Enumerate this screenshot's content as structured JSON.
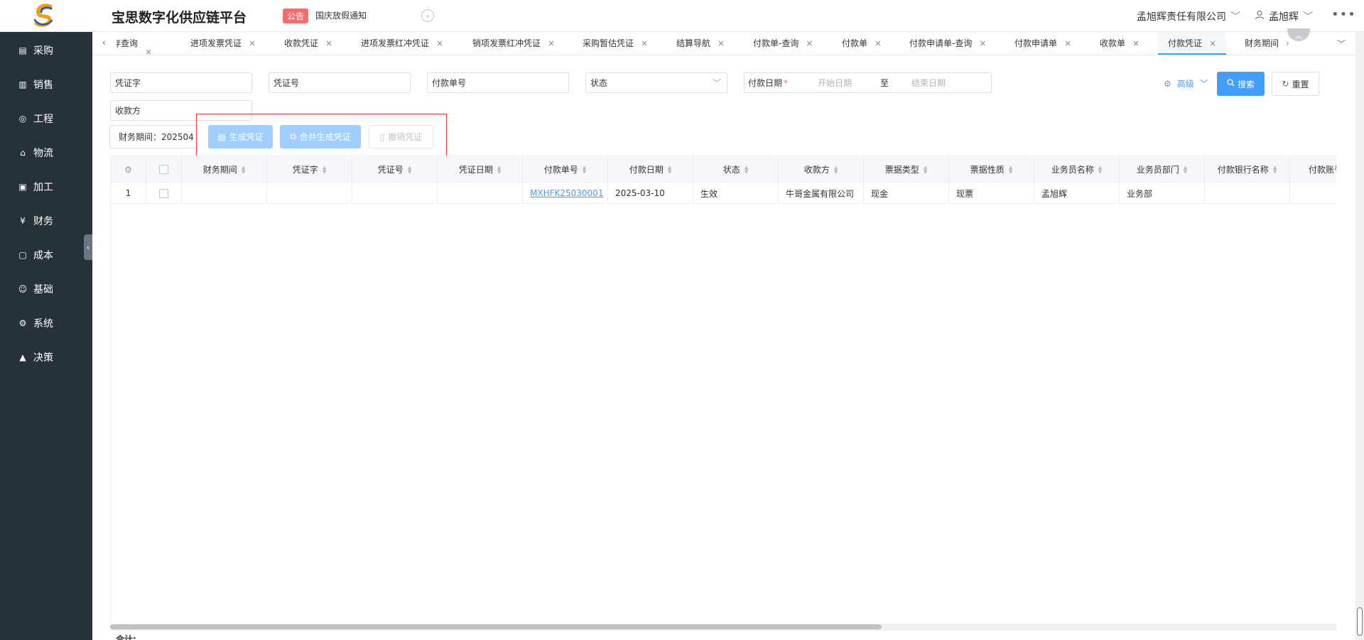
{
  "app": {
    "title": "宝思数字化供应链平台"
  },
  "notice": {
    "badge": "公告",
    "text": "国庆放假通知"
  },
  "header": {
    "company": "孟旭辉责任有限公司",
    "user": "孟旭辉"
  },
  "sidebar": {
    "items": [
      {
        "label": "采购",
        "icon": "purchase-icon"
      },
      {
        "label": "销售",
        "icon": "sales-chart-icon"
      },
      {
        "label": "工程",
        "icon": "compass-icon"
      },
      {
        "label": "物流",
        "icon": "home-icon"
      },
      {
        "label": "加工",
        "icon": "process-icon"
      },
      {
        "label": "财务",
        "icon": "yen-icon"
      },
      {
        "label": "成本",
        "icon": "cost-icon"
      },
      {
        "label": "基础",
        "icon": "smile-icon"
      },
      {
        "label": "系统",
        "icon": "gear-icon"
      },
      {
        "label": "决策",
        "icon": "decision-chart-icon"
      }
    ]
  },
  "tabs": [
    {
      "label": "库存查询"
    },
    {
      "label": "进项发票凭证"
    },
    {
      "label": "收款凭证"
    },
    {
      "label": "进项发票红冲凭证"
    },
    {
      "label": "销项发票红冲凭证"
    },
    {
      "label": "采购暂估凭证"
    },
    {
      "label": "结算导航"
    },
    {
      "label": "付款单-查询"
    },
    {
      "label": "付款单"
    },
    {
      "label": "付款申请单-查询"
    },
    {
      "label": "付款申请单"
    },
    {
      "label": "收款单"
    },
    {
      "label": "付款凭证",
      "active": true
    },
    {
      "label": "财务期间"
    }
  ],
  "filters": {
    "voucher_word": {
      "value": "凭证字"
    },
    "voucher_no": {
      "value": "凭证号"
    },
    "payment_no": {
      "value": "付款单号"
    },
    "status": {
      "value": "状态"
    },
    "payment_date": {
      "label": "付款日期",
      "required": "*",
      "start_placeholder": "开始日期",
      "separator": "至",
      "end_placeholder": "结束日期"
    },
    "payee": {
      "value": "收款方"
    }
  },
  "actions": {
    "advanced": "高级",
    "search": "搜索",
    "reset": "重置"
  },
  "toolbar": {
    "period": "财务期间：202504",
    "generate": "生成凭证",
    "merge_generate": "合并生成凭证",
    "cancel": "撤销凭证"
  },
  "table": {
    "columns": [
      "财务期间",
      "凭证字",
      "凭证号",
      "凭证日期",
      "付款单号",
      "付款日期",
      "状态",
      "收款方",
      "票据类型",
      "票据性质",
      "业务员名称",
      "业务员部门",
      "付款银行名称",
      "付款账号"
    ],
    "rows": [
      {
        "index": "1",
        "period": "",
        "voucher_word": "",
        "voucher_no": "",
        "voucher_date": "",
        "payment_no": "MXHFK25030001",
        "payment_date": "2025-03-10",
        "status": "生效",
        "payee": "牛哥金属有限公司",
        "bill_type": "现金",
        "bill_nature": "现票",
        "salesman": "孟旭辉",
        "dept": "业务部",
        "bank": "",
        "account": ""
      }
    ],
    "footer": {
      "sum_label": "合计:"
    }
  }
}
